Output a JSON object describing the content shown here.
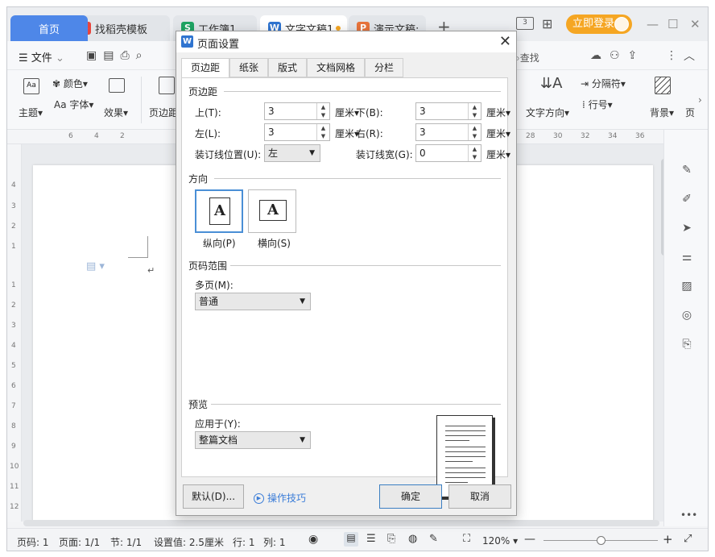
{
  "tabs": {
    "home": "首页",
    "daoke": "找稻壳模板",
    "sheet": "工作簿1",
    "doc": "文字文稿1",
    "ppt": "演示文稿:",
    "add": "+"
  },
  "topbar": {
    "login": "立即登录"
  },
  "menu": {
    "file": "文件",
    "search": "查找"
  },
  "ribbon": {
    "theme": "主题",
    "color": "颜色",
    "font": "Aa 字体",
    "effect": "效果",
    "margin": "页边距",
    "text_dir": "文字方向",
    "separator": "分隔符",
    "line_no": "行号",
    "background": "背景",
    "more": "页"
  },
  "ruler": {
    "h_ticks": [
      "6",
      "4",
      "2",
      "28",
      "30",
      "32",
      "34",
      "36"
    ],
    "v_ticks": [
      "4",
      "3",
      "2",
      "1",
      "1",
      "2",
      "3",
      "4",
      "5",
      "6",
      "7",
      "8",
      "9",
      "10",
      "11",
      "12"
    ]
  },
  "dialog": {
    "title": "页面设置",
    "tabs": [
      "页边距",
      "纸张",
      "版式",
      "文档网格",
      "分栏"
    ],
    "sections": {
      "margins": "页边距",
      "orientation": "方向",
      "page_range": "页码范围",
      "preview": "预览"
    },
    "fields": {
      "top": {
        "label": "上(T):",
        "value": "3",
        "unit": "厘米"
      },
      "bottom": {
        "label": "下(B):",
        "value": "3",
        "unit": "厘米"
      },
      "left": {
        "label": "左(L):",
        "value": "3",
        "unit": "厘米"
      },
      "right": {
        "label": "右(R):",
        "value": "3",
        "unit": "厘米"
      },
      "gutter_pos": {
        "label": "装订线位置(U):",
        "value": "左"
      },
      "gutter_width": {
        "label": "装订线宽(G):",
        "value": "0",
        "unit": "厘米"
      }
    },
    "orientation": {
      "portrait": "纵向(P)",
      "landscape": "横向(S)",
      "glyph": "A",
      "selected": "portrait"
    },
    "page_range": {
      "label": "多页(M):",
      "value": "普通"
    },
    "apply": {
      "label": "应用于(Y):",
      "value": "整篇文档"
    },
    "buttons": {
      "default": "默认(D)...",
      "tips": "操作技巧",
      "ok": "确定",
      "cancel": "取消"
    }
  },
  "status": {
    "page_no": "页码: 1",
    "pages": "页面: 1/1",
    "section": "节: 1/1",
    "setting": "设置值: 2.5厘米",
    "row": "行: 1",
    "col": "列: 1",
    "zoom": "120%"
  },
  "colors": {
    "accent": "#4e87e8",
    "login": "#f5a623",
    "tips_link": "#3b7dd8"
  }
}
